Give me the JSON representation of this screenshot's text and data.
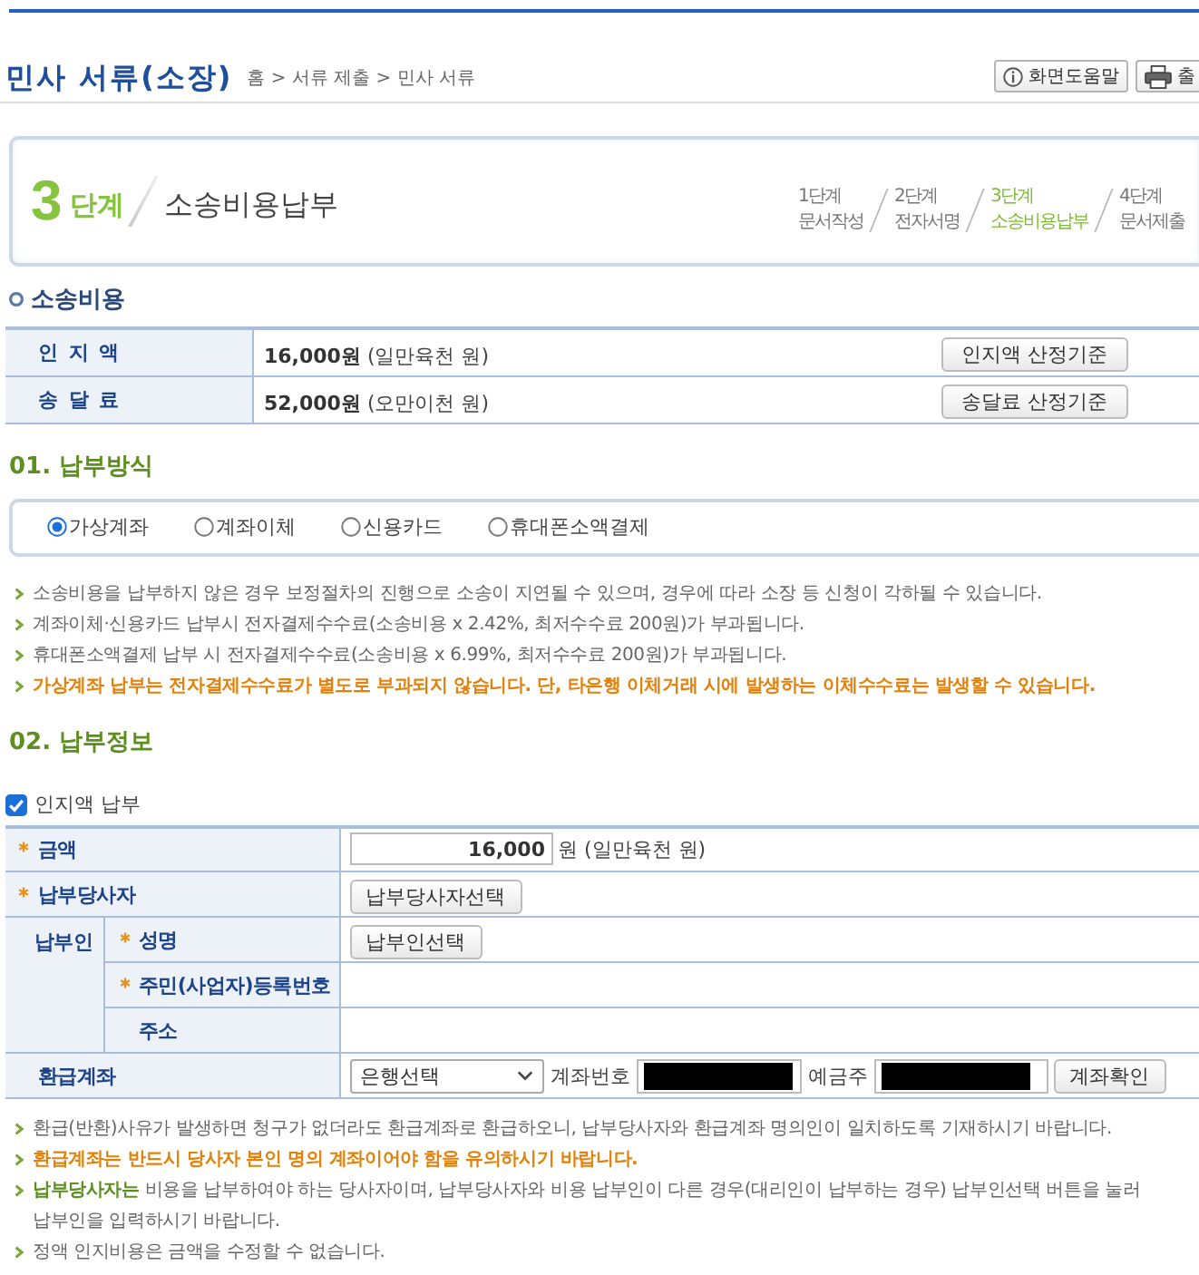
{
  "header": {
    "title": "민사 서류(소장)",
    "breadcrumb": "홈 > 서류 제출 > 민사 서류",
    "buttons": [
      {
        "kind": "help",
        "label": "화면도움말"
      },
      {
        "kind": "print",
        "label": "출"
      }
    ]
  },
  "step_banner": {
    "number": "3",
    "unit": "단계",
    "title": "소송비용납부",
    "steps": [
      {
        "step": "1단계",
        "name": "문서작성",
        "selected": false
      },
      {
        "step": "2단계",
        "name": "전자서명",
        "selected": false
      },
      {
        "step": "3단계",
        "name": "소송비용납부",
        "selected": true
      },
      {
        "step": "4단계",
        "name": "문서제출",
        "selected": false
      }
    ]
  },
  "litigation_costs": {
    "title": "소송비용",
    "rows": [
      {
        "label": "인 지 액",
        "value": "**16,000원** (일만육천 원)",
        "button": "인지액 산정기준"
      },
      {
        "label": "송 달 료",
        "value": "**52,000원** (오만이천 원)",
        "button": "송달료 산정기준"
      }
    ]
  },
  "payment_method": {
    "title": "01. 납부방식",
    "options": [
      {
        "label": "가상계좌",
        "selected": true
      },
      {
        "label": "계좌이체",
        "selected": false
      },
      {
        "label": "신용카드",
        "selected": false
      },
      {
        "label": "휴대폰소액결제",
        "selected": false
      }
    ],
    "notes": [
      {
        "kind": "normal",
        "text": "소송비용을 납부하지 않은 경우 보정절차의 진행으로 소송이 지연될 수 있으며, 경우에 따라 소장 등 신청이 각하될 수 있습니다."
      },
      {
        "kind": "normal",
        "text": "계좌이체·신용카드 납부시 전자결제수수료(소송비용 x 2.42%, 최저수수료 200원)가 부과됩니다."
      },
      {
        "kind": "normal",
        "text": "휴대폰소액결제 납부 시 전자결제수수료(소송비용 x 6.99%, 최저수수료 200원)가 부과됩니다."
      },
      {
        "kind": "warning",
        "text": "가상계좌 납부는 전자결제수수료가 별도로 부과되지 않습니다. 단, 타은행 이체거래 시에 발생하는 이체수수료는 발생할 수 있습니다."
      }
    ]
  },
  "payment_info": {
    "title": "02. 납부정보",
    "stamp_checkbox": {
      "label": "인지액 납부",
      "checked": true
    },
    "amount": {
      "label": "금액",
      "required": true,
      "value": "16,000",
      "suffix": "원 (일만육천 원)"
    },
    "paying_party": {
      "label": "납부당사자",
      "required": true,
      "button": "납부당사자선택"
    },
    "payer": {
      "label": "납부인",
      "fields": [
        {
          "label": "성명",
          "required": true,
          "button": "납부인선택"
        },
        {
          "label": "주민(사업자)등록번호",
          "required": true
        },
        {
          "label": "주소",
          "required": false
        }
      ]
    },
    "refund_account": {
      "label": "환급계좌",
      "bank_select": "은행선택",
      "account_number": {
        "label": "계좌번호",
        "redacted": true
      },
      "account_holder": {
        "label": "예금주",
        "redacted": true
      },
      "button": "계좌확인"
    },
    "notes": [
      {
        "kind": "normal",
        "text": "환급(반환)사유가 발생하면 청구가 없더라도 환급계좌로 환급하오니, 납부당사자와 환급계좌 명의인이 일치하도록 기재하시기 바랍니다."
      },
      {
        "kind": "warning",
        "text": "환급계좌는 반드시 당사자 본인 명의 계좌이어야 함을 유의하시기 바랍니다."
      },
      {
        "kind": "normal",
        "text": "**납부당사자는** 비용을 납부하여야 하는 당사자이며, 납부당사자와 비용 납부인이 다른 경우(대리인이 납부하는 경우) 납부인선택 버튼을 눌러 납부인을 입력하시기 바랍니다."
      },
      {
        "kind": "normal",
        "text": "정액 인지비용은 금액을 수정할 수 없습니다."
      }
    ]
  }
}
